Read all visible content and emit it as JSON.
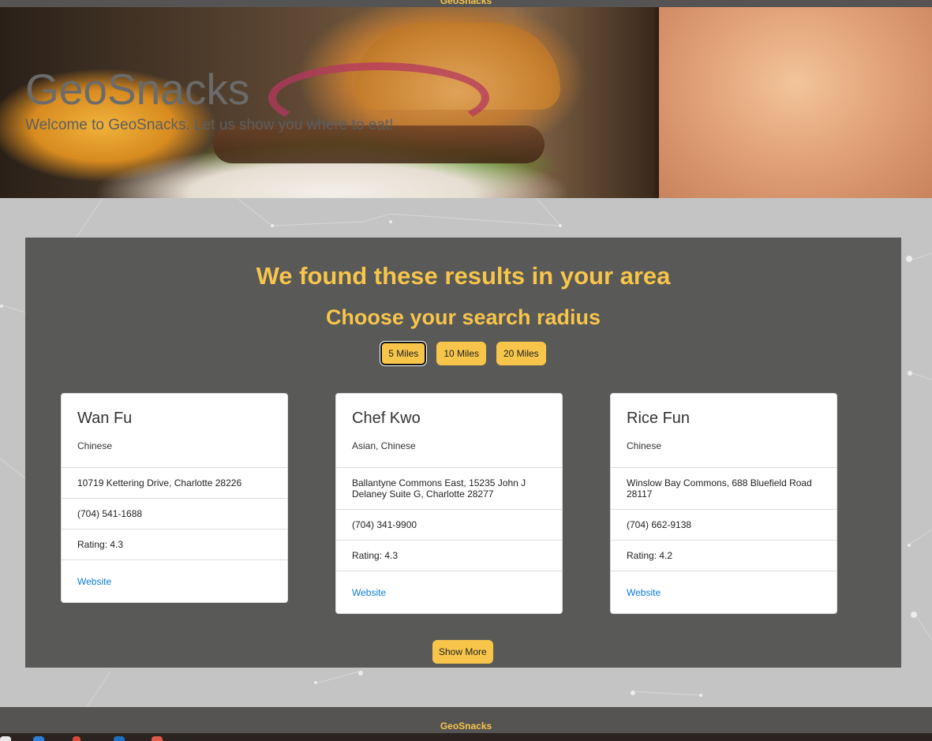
{
  "top_bar": {
    "title": "GeoSnacks"
  },
  "hero": {
    "title": "GeoSnacks",
    "subtitle": "Welcome to GeoSnacks. Let us show you where to eat!"
  },
  "results": {
    "heading": "We found these results in your area",
    "radius_heading": "Choose your search radius",
    "radius_options": [
      "5 Miles",
      "10 Miles",
      "20 Miles"
    ],
    "selected_radius": "5 Miles",
    "cards": [
      {
        "name": "Wan Fu",
        "category": "Chinese",
        "address": "10719 Kettering Drive, Charlotte 28226",
        "phone": "(704) 541-1688",
        "rating": "Rating: 4.3",
        "website_label": "Website"
      },
      {
        "name": "Chef Kwo",
        "category": "Asian, Chinese",
        "address": "Ballantyne Commons East, 15235 John J Delaney Suite G, Charlotte 28277",
        "phone": "(704) 341-9900",
        "rating": "Rating: 4.3",
        "website_label": "Website"
      },
      {
        "name": "Rice Fun",
        "category": "Chinese",
        "address": "Winslow Bay Commons, 688 Bluefield Road 28117",
        "phone": "(704) 662-9138",
        "rating": "Rating: 4.2",
        "website_label": "Website"
      }
    ],
    "show_more_label": "Show More"
  },
  "footer": {
    "title": "GeoSnacks"
  },
  "colors": {
    "accent": "#f7c54a",
    "panel": "#595958",
    "nav": "#555453",
    "page_bg": "#c4c4c4",
    "link": "#0a7bd6"
  }
}
